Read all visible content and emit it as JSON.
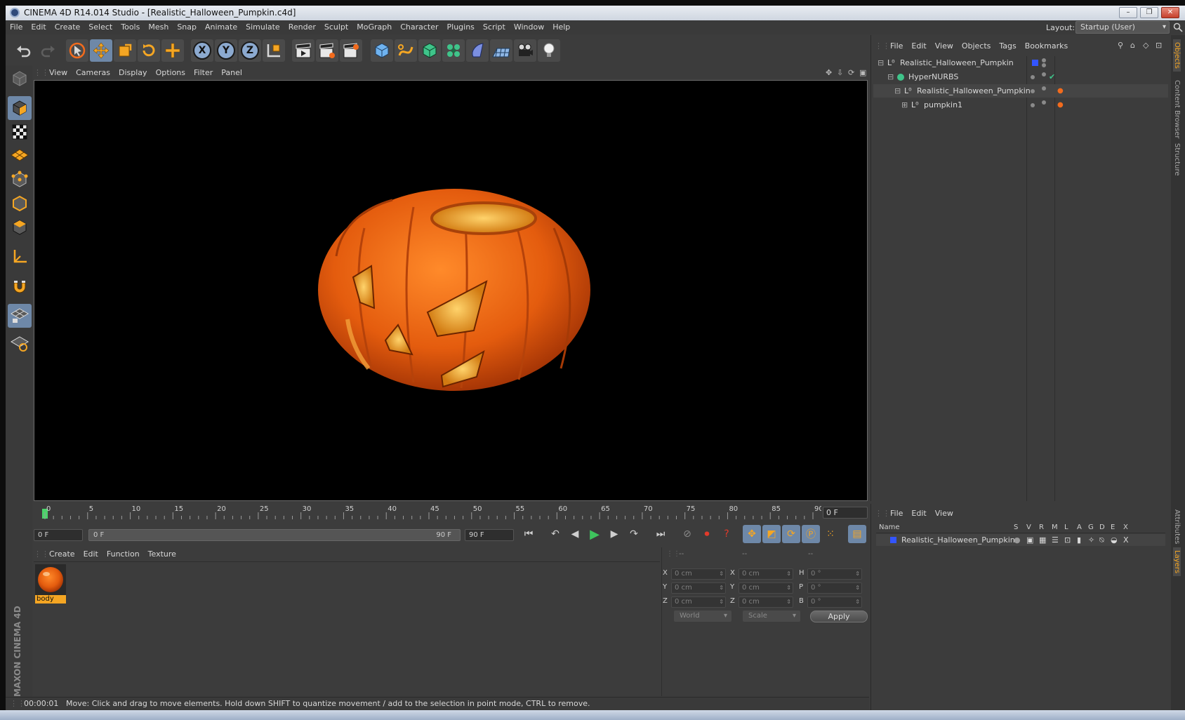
{
  "window": {
    "title": "CINEMA 4D R14.014 Studio - [Realistic_Halloween_Pumpkin.c4d]",
    "controls": [
      "–",
      "❐",
      "✕"
    ]
  },
  "menubar": {
    "items": [
      "File",
      "Edit",
      "Create",
      "Select",
      "Tools",
      "Mesh",
      "Snap",
      "Animate",
      "Simulate",
      "Render",
      "Sculpt",
      "MoGraph",
      "Character",
      "Plugins",
      "Script",
      "Window",
      "Help"
    ],
    "layout_label": "Layout:",
    "layout_value": "Startup (User)"
  },
  "toolbar": {
    "axis_x": "X",
    "axis_y": "Y",
    "axis_z": "Z"
  },
  "viewport": {
    "menu": [
      "View",
      "Cameras",
      "Display",
      "Options",
      "Filter",
      "Panel"
    ],
    "render_subject": "pumpkin"
  },
  "timeline": {
    "ticks": [
      "0",
      "5",
      "10",
      "15",
      "20",
      "25",
      "30",
      "35",
      "40",
      "45",
      "50",
      "55",
      "60",
      "65",
      "70",
      "75",
      "80",
      "85",
      "90"
    ],
    "current_frame": "0 F",
    "start_field": "0 F",
    "range_start": "0 F",
    "range_end": "90 F",
    "end_field": "90 F"
  },
  "material_manager": {
    "menu": [
      "Create",
      "Edit",
      "Function",
      "Texture"
    ],
    "materials": [
      {
        "name": "body"
      }
    ]
  },
  "coordinates": {
    "header": [
      "--",
      "--",
      "--"
    ],
    "rows": [
      {
        "a": "X",
        "av": "0 cm",
        "b": "X",
        "bv": "0 cm",
        "c": "H",
        "cv": "0 °"
      },
      {
        "a": "Y",
        "av": "0 cm",
        "b": "Y",
        "bv": "0 cm",
        "c": "P",
        "cv": "0 °"
      },
      {
        "a": "Z",
        "av": "0 cm",
        "b": "Z",
        "bv": "0 cm",
        "c": "B",
        "cv": "0 °"
      }
    ],
    "mode": "World",
    "transform": "Scale",
    "apply": "Apply"
  },
  "object_manager": {
    "menu": [
      "File",
      "Edit",
      "View",
      "Objects",
      "Tags",
      "Bookmarks"
    ],
    "objects": [
      {
        "name": "Realistic_Halloween_Pumpkin"
      },
      {
        "name": "HyperNURBS"
      },
      {
        "name": "Realistic_Halloween_Pumpkin"
      },
      {
        "name": "pumpkin1"
      }
    ]
  },
  "layer_manager": {
    "menu": [
      "File",
      "Edit",
      "View"
    ],
    "columns": [
      "Name",
      "S",
      "V",
      "R",
      "M",
      "L",
      "A",
      "G",
      "D",
      "E",
      "X"
    ],
    "layers": [
      {
        "name": "Realistic_Halloween_Pumpkin",
        "color": "#3355ff"
      }
    ]
  },
  "side_tabs": [
    "Objects",
    "Content Browser",
    "Structure",
    "Attributes",
    "Layers"
  ],
  "statusbar": {
    "time": "00:00:01",
    "message": "Move: Click and drag to move elements. Hold down SHIFT to quantize movement / add to the selection in point mode, CTRL to remove."
  },
  "branding": {
    "logo_text": "MAXON CINEMA 4D"
  },
  "colors": {
    "accent": "#f5a623",
    "active_tool": "#6e88a8",
    "pumpkin": "#e8641a"
  }
}
